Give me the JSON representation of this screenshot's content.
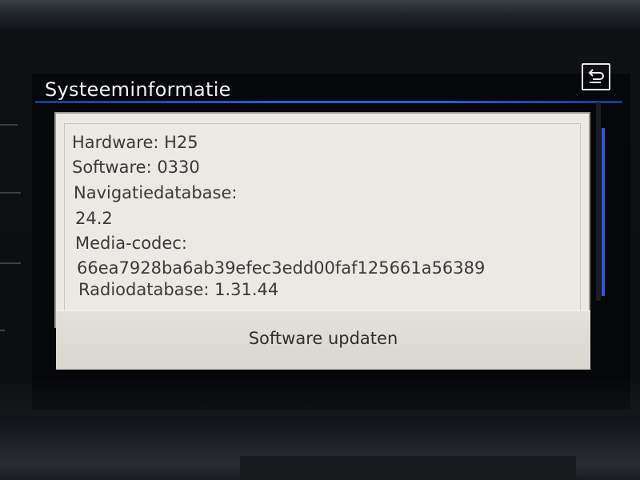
{
  "header": {
    "title": "Systeeminformatie",
    "back_icon": "back-arrow-icon"
  },
  "info": {
    "lines": [
      "Hardware: H25",
      "Software: 0330",
      "Navigatiedatabase:",
      "24.2",
      "Media-codec:",
      "66ea7928ba6ab39efec3edd00faf125661a56389",
      "Radiodatabase: 1.31.44"
    ]
  },
  "actions": {
    "update_label": "Software updaten"
  },
  "colors": {
    "accent": "#2a5ae0",
    "panel_bg": "#ece9e4",
    "text": "#3a3a3a"
  }
}
